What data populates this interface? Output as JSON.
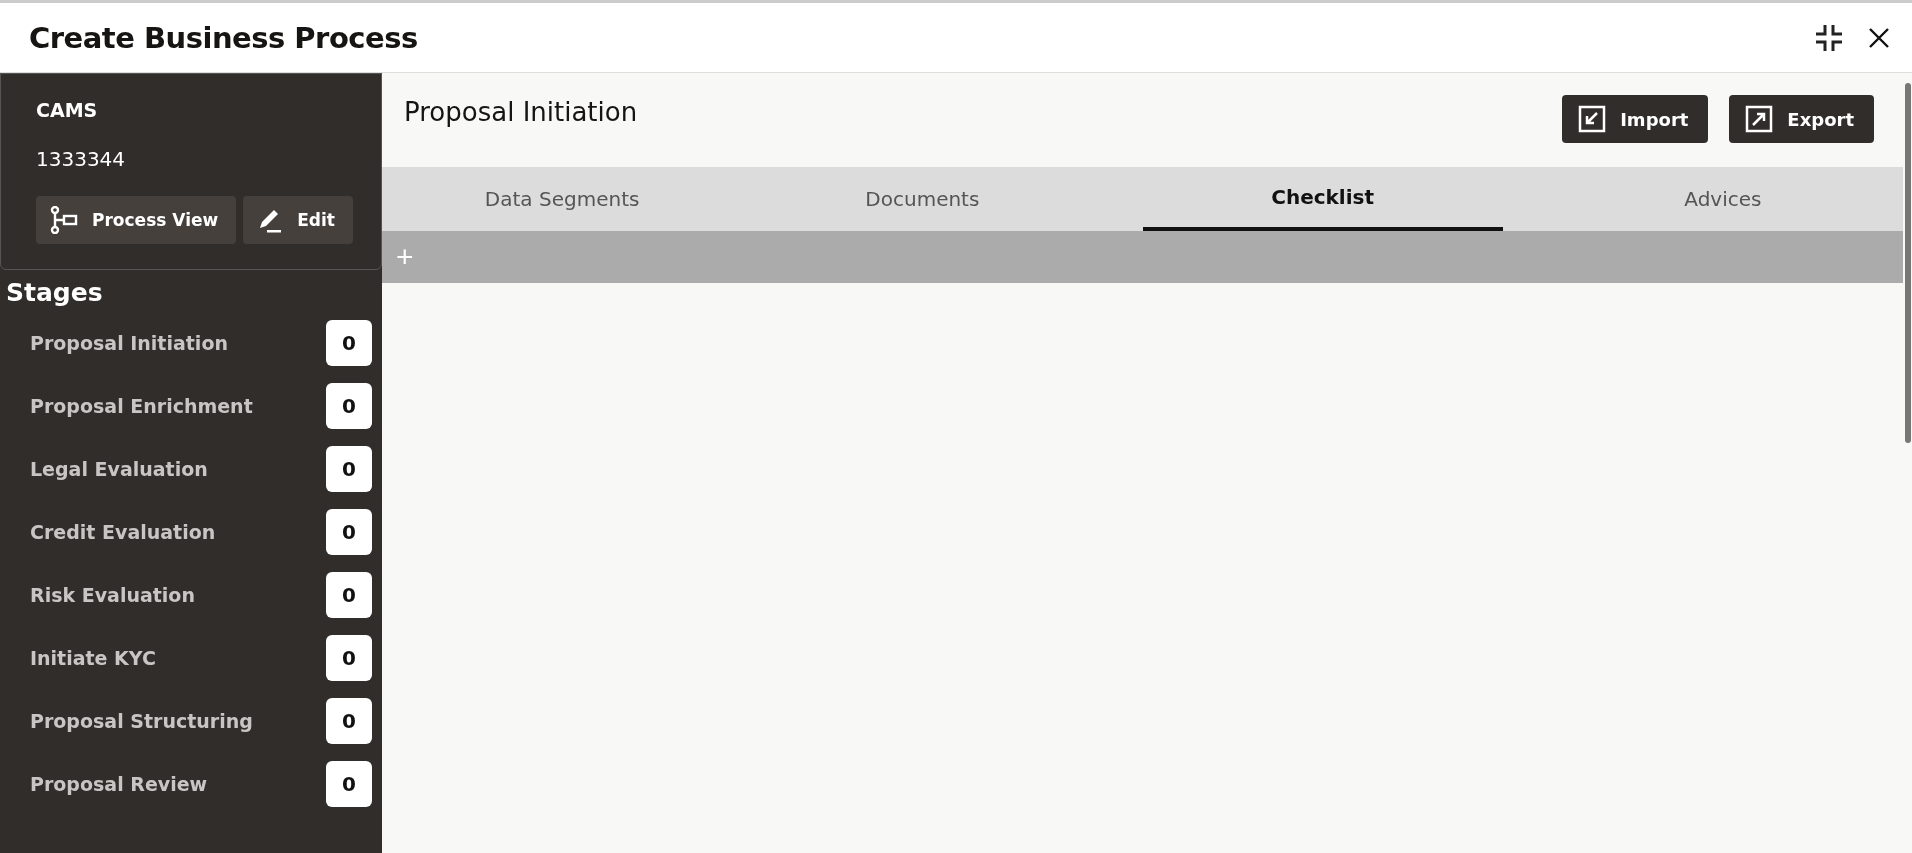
{
  "window": {
    "title": "Create Business Process"
  },
  "sidebar": {
    "name": "CAMS",
    "code": "1333344",
    "buttons": [
      "Process View",
      "Edit"
    ],
    "stages_title": "Stages",
    "stages": [
      {
        "label": "Proposal Initiation",
        "count": "0"
      },
      {
        "label": "Proposal Enrichment",
        "count": "0"
      },
      {
        "label": "Legal Evaluation",
        "count": "0"
      },
      {
        "label": "Credit Evaluation",
        "count": "0"
      },
      {
        "label": "Risk Evaluation",
        "count": "0"
      },
      {
        "label": "Initiate KYC",
        "count": "0"
      },
      {
        "label": "Proposal Structuring",
        "count": "0"
      },
      {
        "label": "Proposal Review",
        "count": "0"
      }
    ]
  },
  "main": {
    "title": "Proposal Initiation",
    "actions": [
      "Import",
      "Export"
    ],
    "tabs": [
      {
        "label": "Data Segments",
        "selected": false
      },
      {
        "label": "Documents",
        "selected": false
      },
      {
        "label": "Checklist",
        "selected": true
      },
      {
        "label": "Advices",
        "selected": false
      }
    ],
    "add_button": "+"
  }
}
